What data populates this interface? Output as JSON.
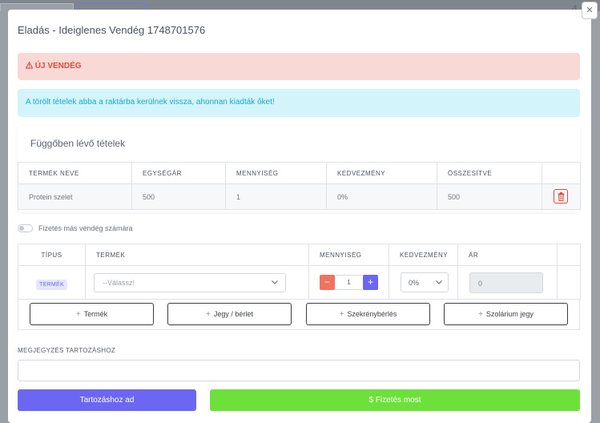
{
  "background": {
    "corner_number": "4"
  },
  "modal": {
    "title": "Eladás - Ideiglenes Vendég 1748701576",
    "close_label": "×"
  },
  "alerts": {
    "new_guest": "ÚJ VENDÉG",
    "info": "A törölt tételek abba a raktárba kerülnek vissza, ahonnan kiadták őket!"
  },
  "pending": {
    "title": "Függőben lévő tételek",
    "columns": [
      "TERMÉK NEVE",
      "EGYSÉGÁR",
      "MENNYISÉG",
      "KEDVEZMÉNY",
      "ÖSSZESÍTVE",
      ""
    ],
    "rows": [
      {
        "name": "Protein szelet",
        "unit_price": "500",
        "quantity": "1",
        "discount": "0%",
        "total": "500"
      }
    ]
  },
  "toggle": {
    "label": "Fizetés más vendég számára"
  },
  "items": {
    "columns": [
      "TÍPUS",
      "TERMÉK",
      "MENNYISÉG",
      "KEDVEZMÉNY",
      "ÁR",
      ""
    ],
    "row": {
      "type_badge": "TERMÉK",
      "product_placeholder": "--Válassz!",
      "quantity_value": "1",
      "minus": "−",
      "plus": "+",
      "discount_value": "0%",
      "price_value": "0"
    },
    "add_buttons": [
      "Termék",
      "Jegy / bérlet",
      "Szekrénybérlés",
      "Szolárium jegy"
    ]
  },
  "note": {
    "label": "MEGJEGYZÉS TARTOZÁSHOZ",
    "value": ""
  },
  "actions": {
    "debt": "Tartozáshoz ad",
    "pay": "$ Fizetés most"
  },
  "colors": {
    "danger": "#e0493a",
    "info": "#1aa9c8",
    "primary": "#6c67f2",
    "success": "#6ee03b"
  }
}
